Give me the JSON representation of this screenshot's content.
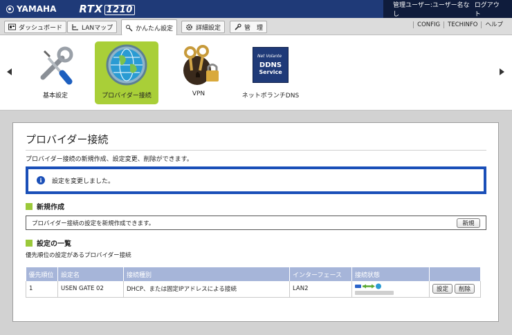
{
  "header": {
    "brand": "YAMAHA",
    "model_prefix": "RTX",
    "model_number": "1210",
    "user_label": "管理ユーザー:ユーザー名なし",
    "logout": "ログアウト"
  },
  "tabs": [
    {
      "label": "ダッシュボード",
      "icon": "dashboard-icon"
    },
    {
      "label": "LANマップ",
      "icon": "lan-map-icon"
    },
    {
      "label": "かんたん設定",
      "icon": "wizard-icon",
      "active": true
    },
    {
      "label": "詳細設定",
      "icon": "gear-icon"
    },
    {
      "label": "管　理",
      "icon": "wrench-icon"
    }
  ],
  "top_links": [
    "CONFIG",
    "TECHINFO",
    "ヘルプ"
  ],
  "quick_settings": [
    {
      "label": "基本設定",
      "icon": "tools-icon"
    },
    {
      "label": "プロバイダー接続",
      "icon": "globe-icon",
      "selected": true
    },
    {
      "label": "VPN",
      "icon": "vpn-keys-lock-icon"
    },
    {
      "label": "ネットボランチDNS",
      "icon": "ddns-icon",
      "badge": {
        "line1": "Net Volante",
        "line2": "DDNS",
        "line3": "Service"
      }
    }
  ],
  "panel": {
    "title": "プロバイダー接続",
    "description": "プロバイダー接続の新規作成、設定変更、削除ができます。",
    "notice": "設定を変更しました。",
    "new_section": {
      "heading": "新規作成",
      "text": "プロバイダー接続の設定を新規作成できます。",
      "button": "新規"
    },
    "list_section": {
      "heading": "設定の一覧",
      "subtitle": "優先順位の設定があるプロバイダー接続",
      "columns": [
        "優先順位",
        "設定名",
        "接続種別",
        "インターフェース",
        "接続状態",
        ""
      ],
      "rows": [
        {
          "priority": "1",
          "name": "USEN GATE 02",
          "type": "DHCP、または固定IPアドレスによる接続",
          "interface": "LAN2",
          "status_icon": "connected-status-icon",
          "edit_button": "設定",
          "delete_button": "削除"
        }
      ]
    }
  },
  "colors": {
    "topbar": "#1f3a78",
    "user_area": "#0f1c3c",
    "selected_tile": "#a9cf38",
    "notice_border": "#1a4fb8",
    "section_square": "#9bc93a",
    "table_header": "#a6b5d9"
  }
}
